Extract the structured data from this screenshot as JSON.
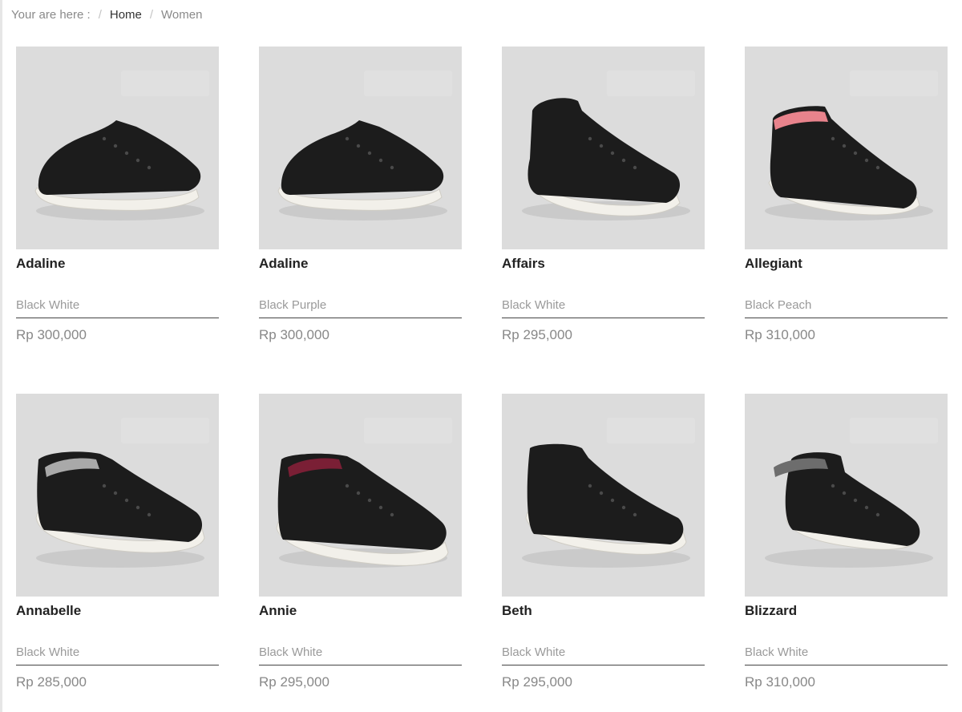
{
  "breadcrumb": {
    "prefix": "Your are here :",
    "items": [
      {
        "label": "Home"
      },
      {
        "label": "Women"
      }
    ]
  },
  "products": [
    {
      "name": "Adaline",
      "color": "Black White",
      "price": "Rp 300,000",
      "style": "low",
      "accent": "#1c1c1c"
    },
    {
      "name": "Adaline",
      "color": "Black Purple",
      "price": "Rp 300,000",
      "style": "low",
      "accent": "#1c1c1c"
    },
    {
      "name": "Affairs",
      "color": "Black White",
      "price": "Rp 295,000",
      "style": "strap-high",
      "accent": "#1c1c1c"
    },
    {
      "name": "Allegiant",
      "color": "Black Peach",
      "price": "Rp 310,000",
      "style": "high-peach",
      "accent": "#e8838c"
    },
    {
      "name": "Annabelle",
      "color": "Black White",
      "price": "Rp 285,000",
      "style": "platform-toe",
      "accent": "#a9a9a9"
    },
    {
      "name": "Annie",
      "color": "Black White",
      "price": "Rp 295,000",
      "style": "platform-mid",
      "accent": "#7a1f35"
    },
    {
      "name": "Beth",
      "color": "Black White",
      "price": "Rp 295,000",
      "style": "platform-high",
      "accent": "#1c1c1c"
    },
    {
      "name": "Blizzard",
      "color": "Black White",
      "price": "Rp 310,000",
      "style": "fold-high",
      "accent": "#6d6d6d"
    }
  ],
  "colors": {
    "thumb_bg": "#dcdcdc",
    "shoe": "#1c1c1c",
    "sole": "#f2f0ea"
  }
}
